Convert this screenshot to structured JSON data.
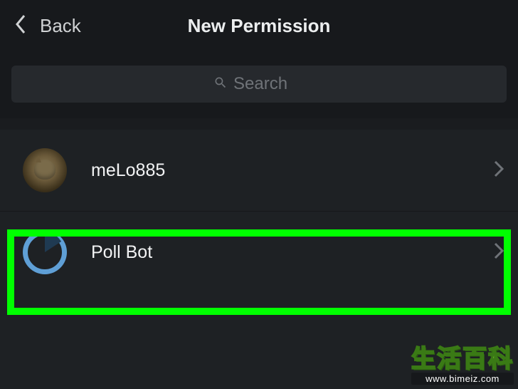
{
  "header": {
    "back_label": "Back",
    "title": "New Permission"
  },
  "search": {
    "placeholder": "Search",
    "value": ""
  },
  "list": {
    "items": [
      {
        "name": "meLo885",
        "avatar_type": "photo"
      },
      {
        "name": "Poll Bot",
        "avatar_type": "pollbot"
      }
    ]
  },
  "watermark": {
    "cn": "生活百科",
    "url": "www.bimeiz.com"
  }
}
